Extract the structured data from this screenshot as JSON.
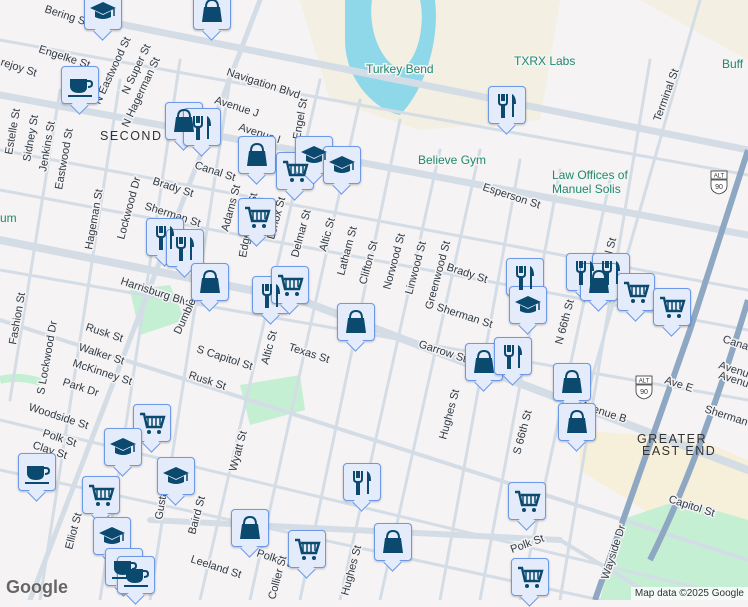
{
  "map": {
    "neighborhoods": [
      "SECOND WARD",
      "GREATER",
      "EAST END"
    ],
    "pois": [
      "Turkey Bend",
      "TXRX Labs",
      "Believe Gym",
      "Law Offices of",
      "Manuel Solis",
      "Buff",
      "um"
    ],
    "streets": [
      "Bering St",
      "Engelke St",
      "rejoy St",
      "Navigation Blvd",
      "N Eastwood St",
      "N Super St",
      "N Hagerman St",
      "Avenue J",
      "Avenue I",
      "Estelle St",
      "Sidney St",
      "Jenkins St",
      "Eastwood St",
      "Canal St",
      "Brady St",
      "Sherman St",
      "Lockwood Dr",
      "Hageman St",
      "Adams St",
      "Edgewood St",
      "Lenox St",
      "Engel St",
      "Delmar St",
      "Altic St",
      "Latham St",
      "Clifton St",
      "Norwood St",
      "Linwood St",
      "Greenwood St",
      "Brady St",
      "Sherman St",
      "Garrow St",
      "Harrisburg Blvd",
      "Rusk St",
      "Walker St",
      "McKinney St",
      "Park Dr",
      "Woodside St",
      "Polk St",
      "Clay St",
      "Dumble St",
      "S Capitol St",
      "Altic St",
      "Texas St",
      "Rusk St",
      "Hughes St",
      "S 66th St",
      "N 66th St",
      "Terminal St",
      "Terminal St",
      "Esperson St",
      "Ave E",
      "Avenue B",
      "Sherman St",
      "Wayside Dr",
      "Capitol St",
      "Polk St",
      "Polk St",
      "Wyatt St",
      "Baird St",
      "Leeland St",
      "Collier St",
      "Hughes St",
      "S Lockwood Dr",
      "Fashion St",
      "Gustav St",
      "Elliot St",
      "Canal St",
      "Avenue",
      "Avenue"
    ],
    "shields": [
      "ALT",
      "90",
      "ALT",
      "90"
    ]
  },
  "markers": [
    "education",
    "shopping",
    "cafe",
    "shopping",
    "restaurant",
    "shopping",
    "grocery",
    "education",
    "education",
    "grocery",
    "restaurant",
    "restaurant",
    "shopping",
    "restaurant",
    "grocery",
    "shopping",
    "restaurant",
    "restaurant",
    "restaurant",
    "restaurant",
    "shopping",
    "grocery",
    "grocery",
    "education",
    "shopping",
    "restaurant",
    "shopping",
    "shopping",
    "grocery",
    "education",
    "cafe",
    "education",
    "grocery",
    "education",
    "cafe",
    "cafe",
    "restaurant",
    "shopping",
    "grocery",
    "shopping",
    "grocery",
    "grocery"
  ],
  "attribution": "Map data ©2025 Google",
  "logo": "Google",
  "colors": {
    "marker_fill": "#e4ecfc",
    "marker_border": "#6c98e8",
    "icon": "#0b4a6e",
    "water": "#8fd8ea",
    "park": "#c4efd3",
    "road": "#d4dde6",
    "highway": "#8ea7c2"
  }
}
